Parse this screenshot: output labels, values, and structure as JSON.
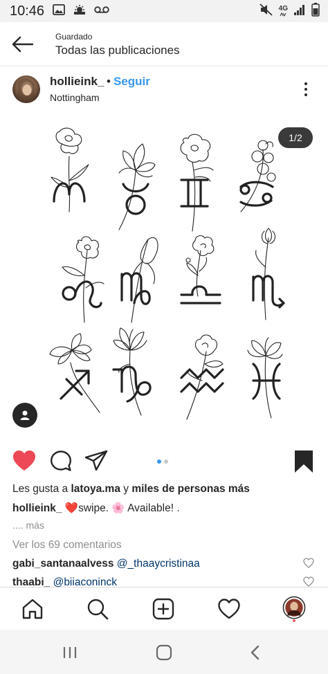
{
  "status_bar": {
    "time": "10:46",
    "network": "4G",
    "left_icons": [
      "gallery-icon",
      "weather-icon",
      "voicemail-icon"
    ],
    "right_icons": [
      "mute-icon",
      "network-4g-icon",
      "signal-icon",
      "battery-icon"
    ]
  },
  "header": {
    "subtitle": "Guardado",
    "title": "Todas las publicaciones"
  },
  "post": {
    "username": "hollieink_",
    "separator": "•",
    "follow_label": "Seguir",
    "location": "Nottingham",
    "counter": "1/2",
    "carousel_pages": 2,
    "carousel_active": 1,
    "liked": true,
    "saved": true,
    "likes": {
      "prefix": "Les gusta a ",
      "user": "latoya.ma",
      "middle": " y ",
      "rest": "miles de personas más"
    },
    "caption": {
      "user": "hollieink_",
      "text": " ❤️swipe. 🌸 Available! ."
    },
    "more_text": ".... más",
    "comments_link": "Ver los 69 comentarios",
    "comments": [
      {
        "user": "gabi_santanaalvess",
        "text": "@_thaaycristinaa"
      },
      {
        "user": "thaabi_",
        "text": "@biiaconinck"
      }
    ]
  },
  "colors": {
    "accent": "#3897f0",
    "like": "#ed4956",
    "text": "#262626",
    "muted": "#8e8e8e"
  }
}
